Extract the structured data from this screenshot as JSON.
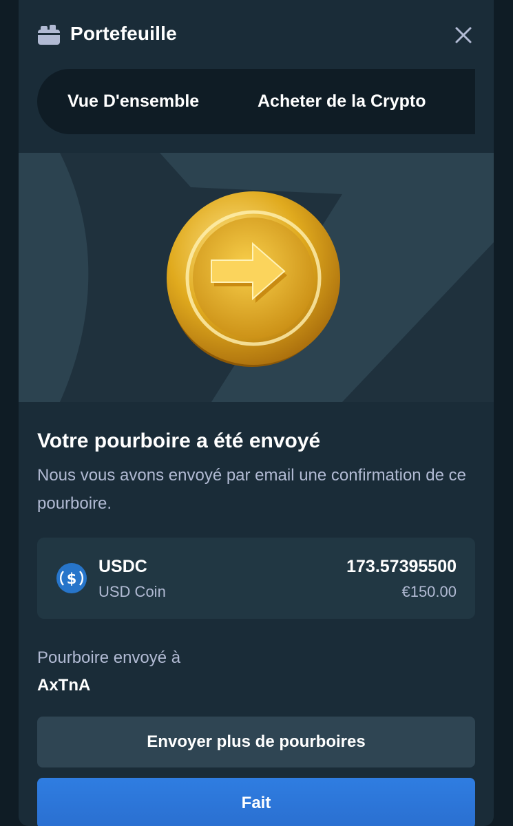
{
  "header": {
    "title": "Portefeuille",
    "icon": "wallet-icon",
    "close_icon": "close-icon"
  },
  "tabs": [
    {
      "label": "Vue D'ensemble"
    },
    {
      "label": "Acheter de la Crypto"
    }
  ],
  "hero": {
    "illustration": "gold-coin-arrow-icon"
  },
  "confirmation": {
    "heading": "Votre pourboire a été envoyé",
    "message": "Nous vous avons envoyé par email une confirmation de ce pourboire."
  },
  "coin": {
    "icon": "usdc-icon",
    "symbol": "USDC",
    "name": "USD Coin",
    "amount": "173.57395500",
    "fiat_value": "€150.00"
  },
  "recipient": {
    "label": "Pourboire envoyé à",
    "username": "AxTnA"
  },
  "actions": {
    "send_more_label": "Envoyer plus de pourboires",
    "done_label": "Fait"
  },
  "colors": {
    "background": "#0f1c25",
    "modal": "#1a2c38",
    "card": "#213743",
    "secondary_button": "#2f4553",
    "primary_button": "#2f7de1",
    "muted_text": "#b1bad3",
    "usdc_blue": "#2775ca",
    "coin_gold": "#e6b422"
  }
}
